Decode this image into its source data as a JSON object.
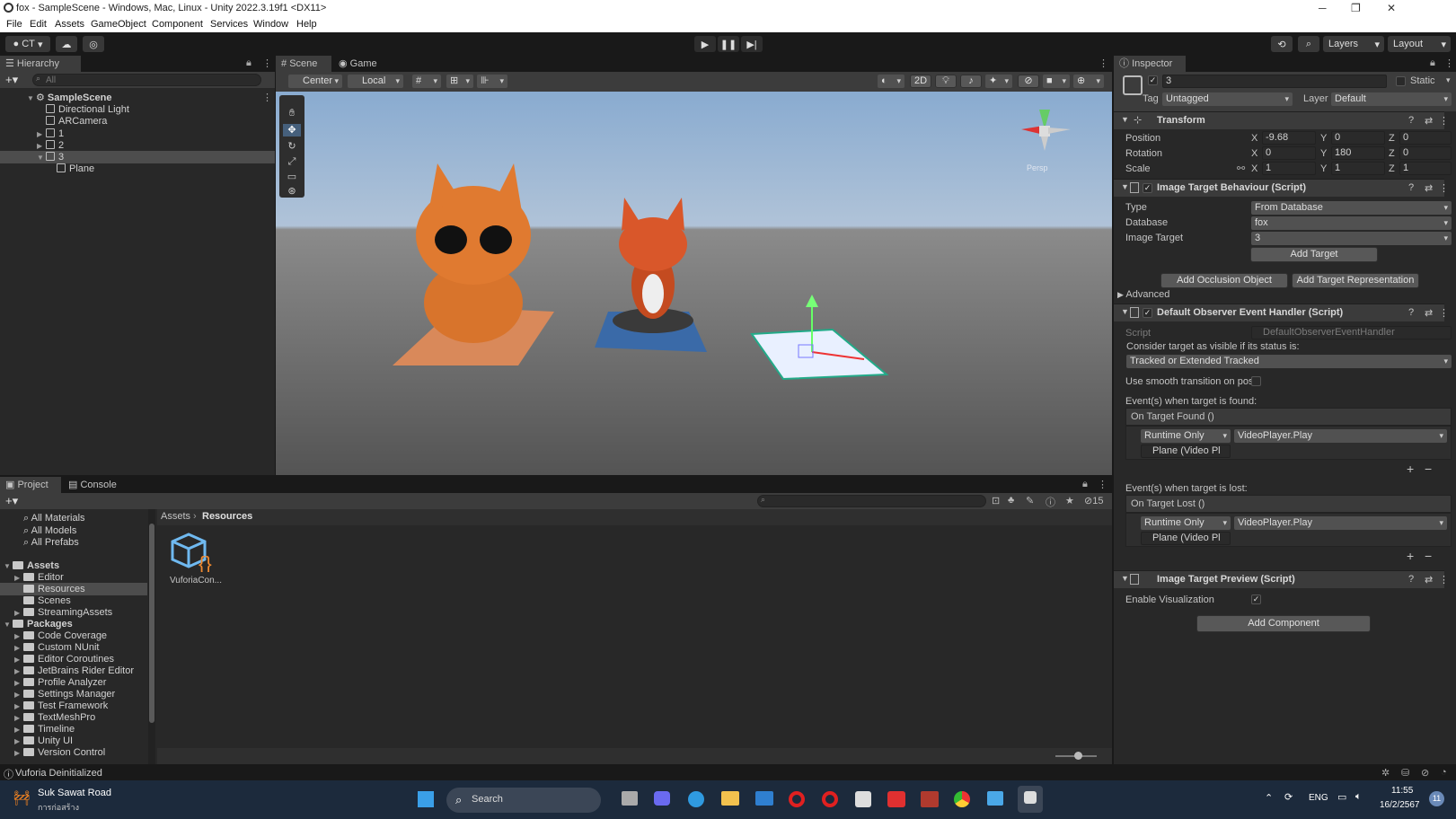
{
  "window": {
    "title": "fox - SampleScene - Windows, Mac, Linux - Unity 2022.3.19f1 <DX11>"
  },
  "menu": [
    "File",
    "Edit",
    "Assets",
    "GameObject",
    "Component",
    "Services",
    "Window",
    "Help"
  ],
  "toolbar": {
    "account": "CT",
    "layers": "Layers",
    "layout": "Layout"
  },
  "hierarchy": {
    "tab": "Hierarchy",
    "search_placeholder": "All",
    "scene": "SampleScene",
    "items": [
      "Directional Light",
      "ARCamera",
      "1",
      "2",
      "3",
      "Plane"
    ]
  },
  "scene_view": {
    "tabs": [
      "Scene",
      "Game"
    ],
    "pivot": "Center",
    "space": "Local",
    "mode_2d": "2D",
    "gizmo_label": "Persp"
  },
  "project": {
    "tabs": [
      "Project",
      "Console"
    ],
    "favorites": [
      "All Materials",
      "All Models",
      "All Prefabs"
    ],
    "assets_root": "Assets",
    "assets": [
      "Editor",
      "Resources",
      "Scenes",
      "StreamingAssets"
    ],
    "packages_root": "Packages",
    "packages": [
      "Code Coverage",
      "Custom NUnit",
      "Editor Coroutines",
      "JetBrains Rider Editor",
      "Profile Analyzer",
      "Settings Manager",
      "Test Framework",
      "TextMeshPro",
      "Timeline",
      "Unity UI",
      "Version Control"
    ],
    "breadcrumb": [
      "Assets",
      "Resources"
    ],
    "file": "VuforiaCon...",
    "hidden_count": "15"
  },
  "inspector": {
    "tab": "Inspector",
    "object_name": "3",
    "static": "Static",
    "tag_label": "Tag",
    "tag": "Untagged",
    "layer_label": "Layer",
    "layer": "Default",
    "transform": {
      "title": "Transform",
      "position_label": "Position",
      "px": "-9.68",
      "py": "0",
      "pz": "0",
      "rotation_label": "Rotation",
      "rx": "0",
      "ry": "180",
      "rz": "0",
      "scale_label": "Scale",
      "sx": "1",
      "sy": "1",
      "sz": "1"
    },
    "itb": {
      "title": "Image Target Behaviour (Script)",
      "type_label": "Type",
      "type": "From Database",
      "database_label": "Database",
      "database": "fox",
      "target_label": "Image Target",
      "target": "3",
      "add_target": "Add Target",
      "add_occlusion": "Add Occlusion Object",
      "add_representation": "Add Target Representation",
      "advanced": "Advanced"
    },
    "doeh": {
      "title": "Default Observer Event Handler (Script)",
      "script_label": "Script",
      "script": "DefaultObserverEventHandler",
      "consider": "Consider target as visible if its status is:",
      "status": "Tracked or Extended Tracked",
      "smooth": "Use smooth transition on posi",
      "found_label": "Event(s) when target is found:",
      "found_event": "On Target Found ()",
      "lost_label": "Event(s) when target is lost:",
      "lost_event": "On Target Lost ()",
      "runtime": "Runtime Only",
      "method": "VideoPlayer.Play",
      "object": "Plane (Video Pl"
    },
    "preview": {
      "title": "Image Target Preview (Script)",
      "enable": "Enable Visualization"
    },
    "add_component": "Add Component"
  },
  "status": {
    "message": "Vuforia Deinitialized"
  },
  "taskbar": {
    "weather_title": "Suk Sawat Road",
    "weather_sub": "การก่อสร้าง",
    "search": "Search",
    "lang": "ENG",
    "time": "11:55",
    "date": "16/2/2567",
    "notif": "11"
  }
}
